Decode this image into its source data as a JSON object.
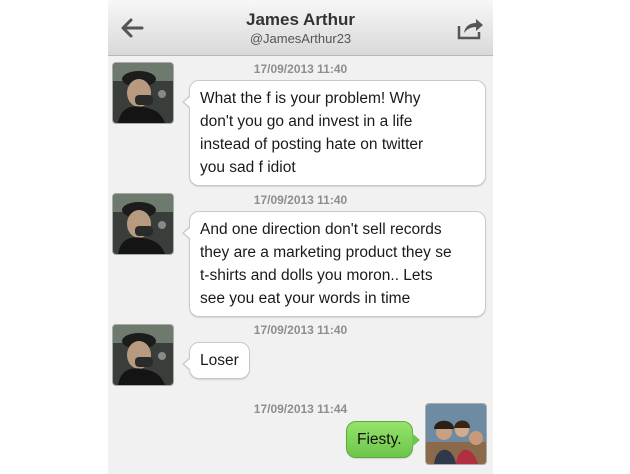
{
  "header": {
    "name": "James Arthur",
    "handle": "@JamesArthur23",
    "back_icon": "back-arrow-icon",
    "share_icon": "share-icon"
  },
  "messages": [
    {
      "timestamp": "17/09/2013 11:40",
      "direction": "incoming",
      "text": "What the f      is your problem! Why\ndon't you go and invest in a life\ninstead of posting hate on twitter\nyou sad f         idiot"
    },
    {
      "timestamp": "17/09/2013 11:40",
      "direction": "incoming",
      "text": "And one direction don't sell records\nthey are a marketing product they se\nt-shirts and dolls you moron.. Lets\nsee you eat your words in time"
    },
    {
      "timestamp": "17/09/2013 11:40",
      "direction": "incoming",
      "text": "Loser"
    },
    {
      "timestamp": "17/09/2013 11:44",
      "direction": "outgoing",
      "text": "Fiesty."
    }
  ],
  "colors": {
    "outgoing_bubble": "#7ed35a",
    "incoming_bubble": "#ffffff",
    "background": "#f1f1f1"
  }
}
